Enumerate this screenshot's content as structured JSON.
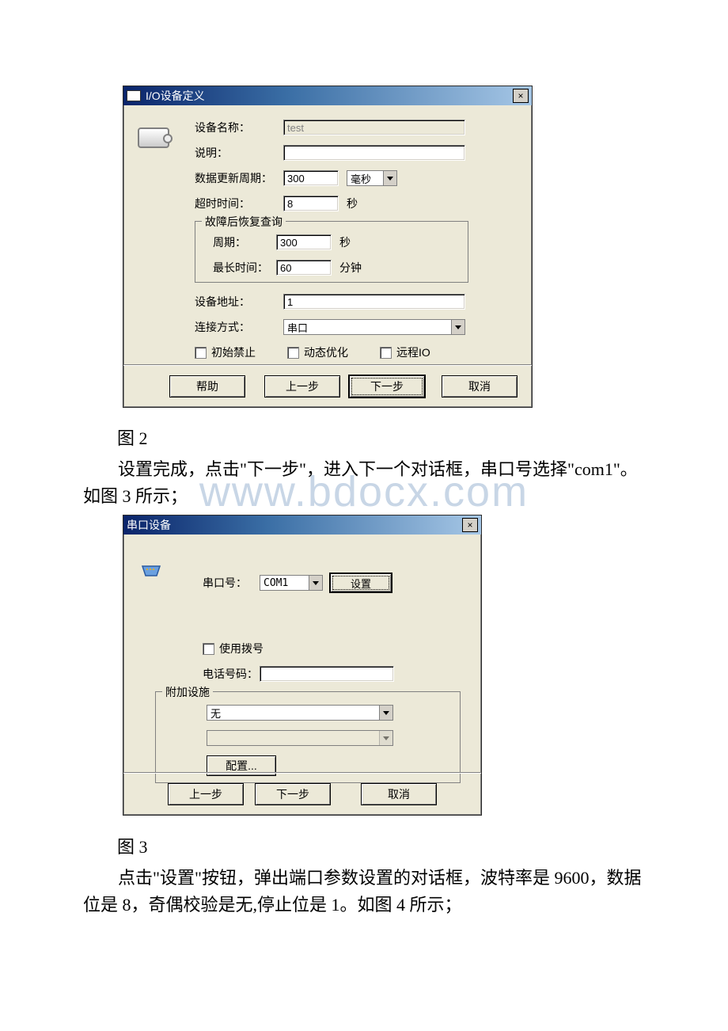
{
  "dialog1": {
    "title": "I/O设备定义",
    "close": "×",
    "labels": {
      "device_name": "设备名称：",
      "desc": "说明：",
      "update_period": "数据更新周期：",
      "timeout": "超时时间：",
      "recover_group": "故障后恢复查询",
      "cycle": "周期：",
      "max_time": "最长时间：",
      "address": "设备地址：",
      "connect": "连接方式：",
      "init_disable": "初始禁止",
      "dyn_opt": "动态优化",
      "remote_io": "远程IO"
    },
    "values": {
      "device_name": "test",
      "desc": "",
      "update_period": "300",
      "update_unit_selected": "毫秒",
      "timeout": "8",
      "timeout_unit": "秒",
      "cycle": "300",
      "cycle_unit": "秒",
      "max_time": "60",
      "max_time_unit": "分钟",
      "address": "1",
      "connect_selected": "串口"
    },
    "buttons": {
      "help": "帮助",
      "prev": "上一步",
      "next": "下一步",
      "cancel": "取消"
    }
  },
  "caption1": "图 2",
  "para1": "设置完成，点击\"下一步\"，进入下一个对话框，串口号选择\"com1\"。如图 3 所示；",
  "dialog2": {
    "title": "串口设备",
    "close": "×",
    "labels": {
      "com_port": "串口号：",
      "use_dial": "使用拨号",
      "phone": "电话号码：",
      "extra_group": "附加设施"
    },
    "values": {
      "com_selected": "COM1",
      "extra_selected": "无",
      "phone": ""
    },
    "buttons": {
      "settings": "设置",
      "config": "配置...",
      "prev": "上一步",
      "next": "下一步",
      "cancel": "取消"
    }
  },
  "caption2": "图 3",
  "para2": "点击\"设置\"按钮，弹出端口参数设置的对话框，波特率是 9600，数据位是 8，奇偶校验是无,停止位是 1。如图 4 所示；",
  "watermark": "www.bdocx.com"
}
